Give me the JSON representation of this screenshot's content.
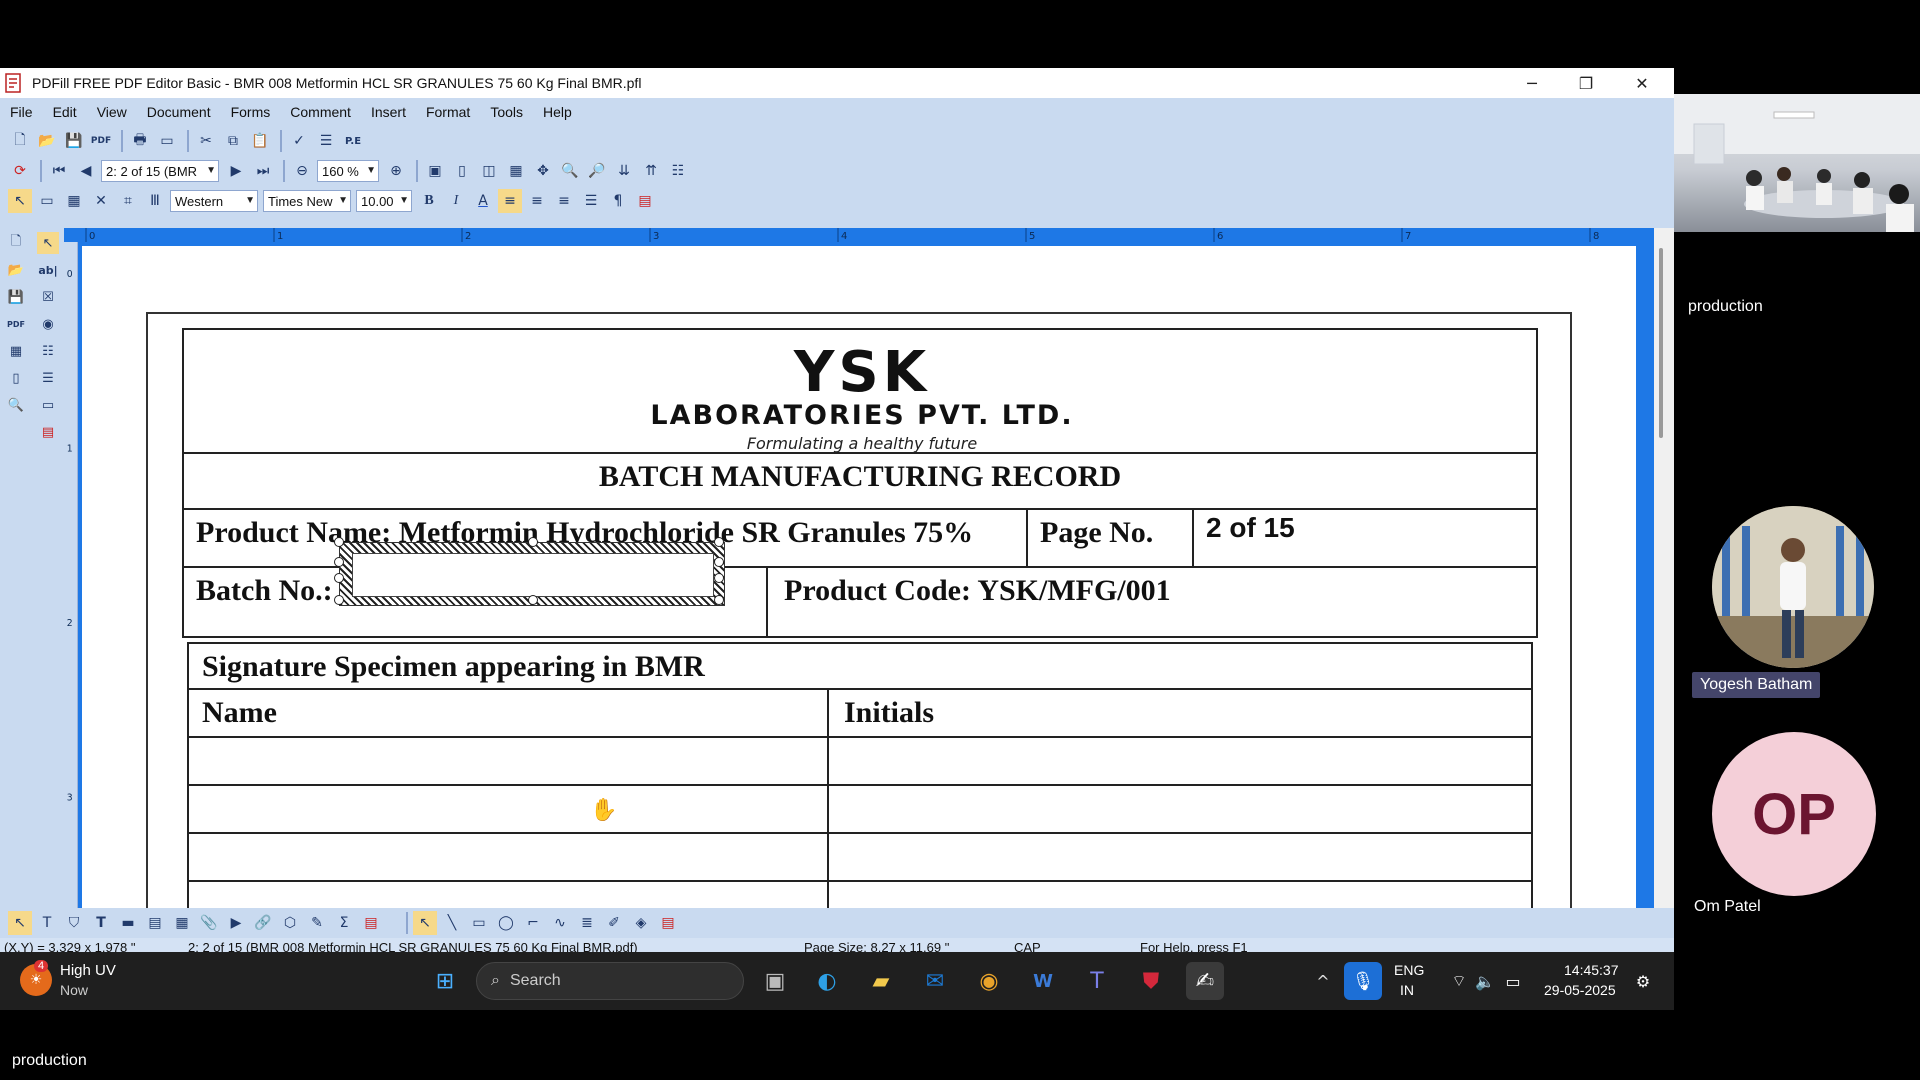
{
  "window": {
    "title": "PDFill FREE PDF Editor Basic - BMR 008 Metformin HCL SR GRANULES 75  60 Kg Final BMR.pfl",
    "controls": {
      "minimize": "─",
      "restore": "❐",
      "close": "✕"
    }
  },
  "menu": [
    "File",
    "Edit",
    "View",
    "Document",
    "Forms",
    "Comment",
    "Insert",
    "Format",
    "Tools",
    "Help"
  ],
  "toolbar": {
    "page_combo": "2: 2 of 15 (BMR",
    "zoom_combo": "160 %",
    "script_combo": "Western",
    "font_combo": "Times New",
    "size_combo": "10.00"
  },
  "document": {
    "company": "YSK",
    "company_full": "LABORATORIES PVT. LTD.",
    "tagline": "Formulating a healthy future",
    "heading": "BATCH MANUFACTURING RECORD",
    "product_name": "Product Name: Metformin Hydrochloride SR Granules 75%",
    "page_no_label": "Page No.",
    "page_no_value": "2 of 15",
    "batch_no_label": "Batch No.:",
    "product_code": "Product Code: YSK/MFG/001",
    "signature_title": "Signature Specimen appearing in BMR",
    "col_name": "Name",
    "col_initials": "Initials"
  },
  "ruler_marks": [
    "0",
    "1",
    "2",
    "3",
    "4",
    "5",
    "6",
    "7",
    "8"
  ],
  "ruler_left_marks": [
    "0",
    "1",
    "2",
    "3"
  ],
  "status": {
    "coords": "(X,Y) = 3.329 x 1.978 \"",
    "page_info": "2: 2 of 15 (BMR 008 Metformin HCL SR GRANULES 75  60 Kg Final BMR.pdf)",
    "page_size": "Page Size: 8.27 x 11.69 \"",
    "caps": "CAP",
    "help": "For Help, press F1"
  },
  "taskbar": {
    "weather_title": "High UV",
    "weather_sub": "Now",
    "weather_badge": "4",
    "search_placeholder": "Search",
    "lang": "ENG",
    "region": "IN",
    "time": "14:45:37",
    "date": "29-05-2025"
  },
  "meeting": {
    "tile_label": "production",
    "participant1": "Yogesh Batham",
    "participant2_initials": "OP",
    "participant2": "Om Patel",
    "bottom_label": "production"
  },
  "colors": {
    "app_bg": "#c9daf0",
    "doc_blue": "#1e78e6",
    "avatar_op_bg": "#f4cfd8",
    "avatar_op_fg": "#6b1530"
  }
}
